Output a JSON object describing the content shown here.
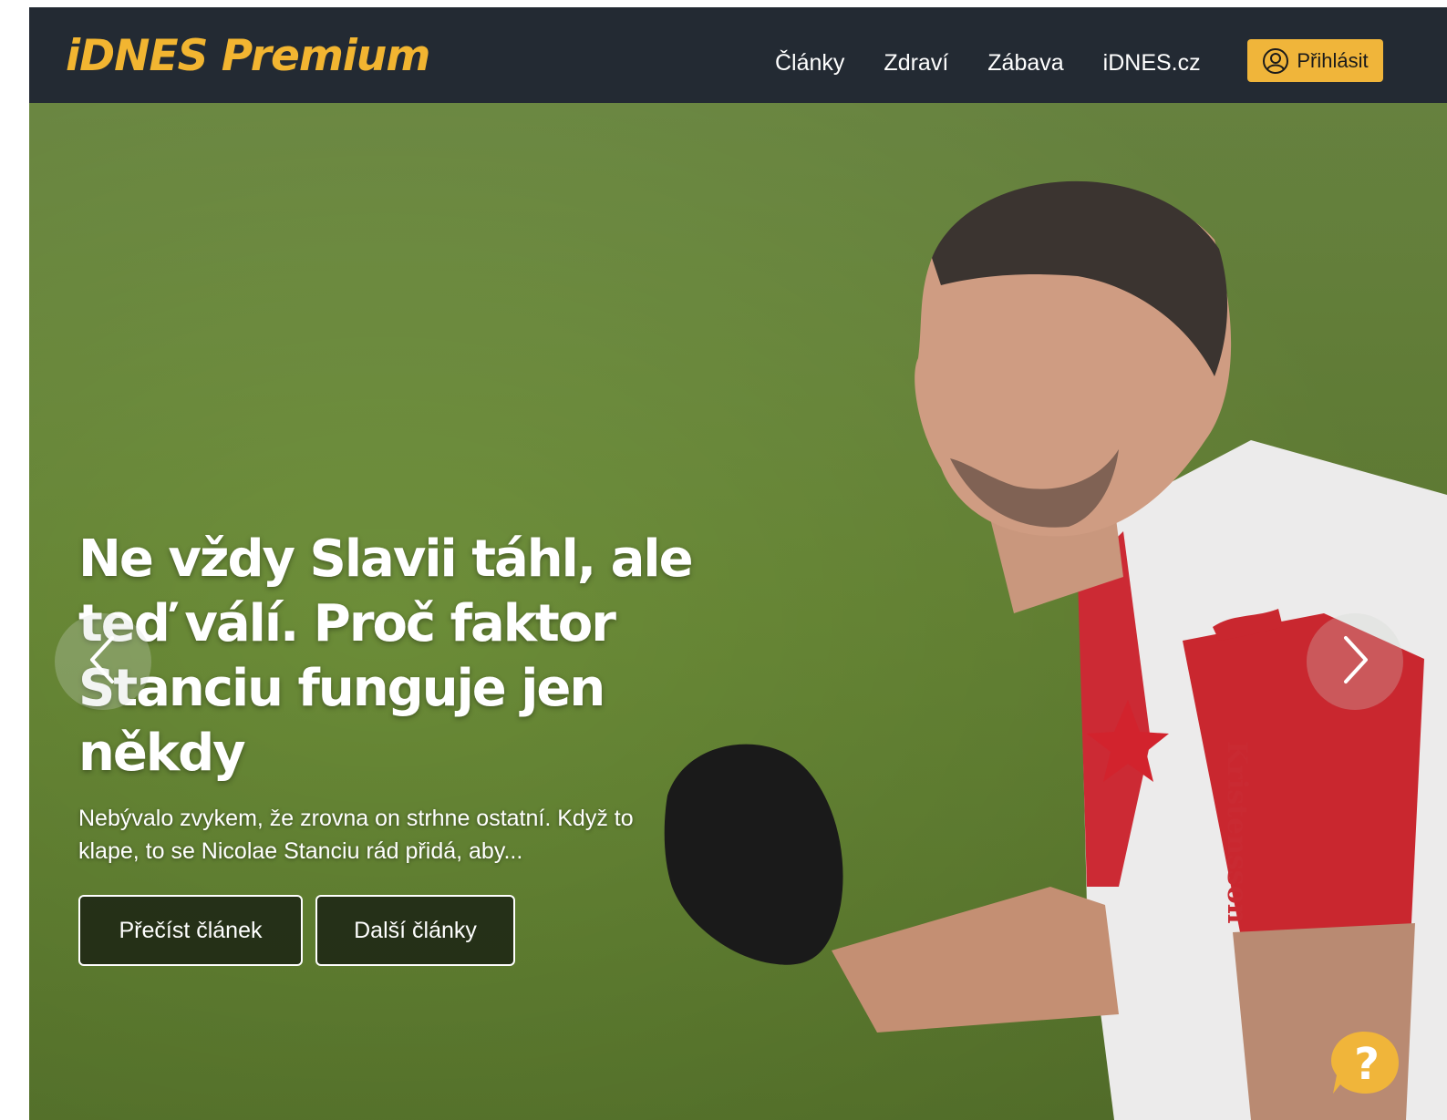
{
  "header": {
    "logo": "iDNES Premium",
    "nav": [
      {
        "label": "Články"
      },
      {
        "label": "Zdraví"
      },
      {
        "label": "Zábava"
      },
      {
        "label": "iDNES.cz"
      }
    ],
    "login_label": "Přihlásit",
    "login_icon": "user-circle-icon"
  },
  "hero": {
    "title_lines": [
      "Ne vždy Slavii táhl, ale",
      "teď válí. Proč faktor",
      "Stanciu funguje jen někdy"
    ],
    "excerpt_lines": [
      "Nebývalo zvykem, že zrovna on strhne ostatní. Když to",
      "klape, to se Nicolae Stanciu rád přidá, aby..."
    ],
    "read_button": "Přečíst článek",
    "more_button": "Další články",
    "prev_icon": "chevron-left-icon",
    "next_icon": "chevron-right-icon",
    "jersey_text": "Kristensson"
  },
  "help_icon": "help-question-icon",
  "colors": {
    "header_bg": "#232a33",
    "brand_yellow": "#f2b531",
    "login_bg": "#f0b53a",
    "grass": "#6f8f3c"
  }
}
